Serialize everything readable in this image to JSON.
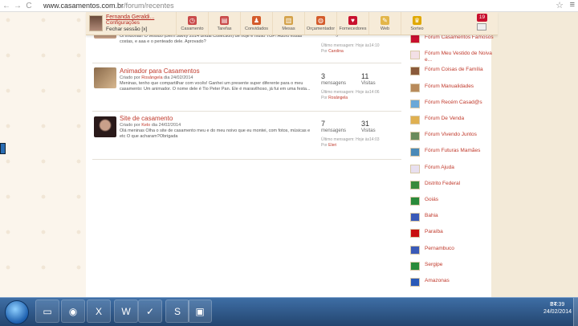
{
  "browser": {
    "url_host": "www.casamentos.com.br",
    "url_path": "/forum/recentes",
    "back": "←",
    "forward": "→",
    "reload": "C",
    "star": "☆",
    "menu": "≡"
  },
  "profile": {
    "name": "Fernanda Geraldi...",
    "settings": "Configurações",
    "logout": "Fechar sessão [x]"
  },
  "nav": [
    {
      "label": "Casamento",
      "color": "#c94a4a",
      "glyph": "◷"
    },
    {
      "label": "Tarefas",
      "color": "#c94a4a",
      "glyph": "▤"
    },
    {
      "label": "Convidados",
      "color": "#d45b2b",
      "glyph": "♟"
    },
    {
      "label": "Mesas",
      "color": "#d4a24a",
      "glyph": "▥"
    },
    {
      "label": "Orçamentador",
      "color": "#d45b2b",
      "glyph": "◍"
    },
    {
      "label": "Fornecedores",
      "color": "#c8102e",
      "glyph": "♥"
    },
    {
      "label": "Web",
      "color": "#e3b64a",
      "glyph": "✎"
    },
    {
      "label": "Sorteo",
      "color": "#e0a800",
      "glyph": "♛"
    }
  ],
  "notifications": "19",
  "topics": [
    {
      "title": "",
      "meta_pre": "",
      "user": "",
      "date": "",
      "desc": "Oi lindonas! O vestido (Bern Savvy 2014 Bridal Collection) de hoje é muito TOP! Adoro essas costas, e aaa e o penteado dele. Aprovado?",
      "num": "",
      "num_label": "mensagens",
      "visits": "",
      "visits_label": "Visitas",
      "last": "Último mensagem: Hoje às14:10",
      "last_by_pre": "Por",
      "last_by": "Carolina"
    },
    {
      "title": "Animador para Casamentos",
      "meta_pre": "Criado por",
      "user": "Rosângela",
      "date": "dia 24/02/2014",
      "desc": "Meninas, tenho que compartilhar com vocês! Ganhei um presente super diferente para o meu casamento: Um animador. O nome dele é Tio Peter Pan. Ele é maravilhoso, já fui em uma festa...",
      "num": "3",
      "num_label": "mensagens",
      "visits": "11",
      "visits_label": "Visitas",
      "last": "Último mensagem: Hoje às14:06",
      "last_by_pre": "Por",
      "last_by": "Rosângela"
    },
    {
      "title": "Site de casamento",
      "meta_pre": "Criado por",
      "user": "Kelo",
      "date": "dia 24/02/2014",
      "desc": "Olá meninas Olha o site de casamento meu e do meu noivo que eu montei, com fotos, músicas e etc O que acharam?Obrigada",
      "num": "7",
      "num_label": "mensagens",
      "visits": "31",
      "visits_label": "Visitas",
      "last": "Último mensagem: Hoje às14:03",
      "last_by_pre": "Por",
      "last_by": "Eleri"
    }
  ],
  "sidebar": [
    {
      "label": "Fórum Casamentos Famosos",
      "color": "#c8102e"
    },
    {
      "label": "Fórum Meu Vestido de Noiva e...",
      "color": "#f3e0e6"
    },
    {
      "label": "Fórum Coisas de Família",
      "color": "#8a5a3a"
    },
    {
      "label": "Fórum Manualidades",
      "color": "#b88a5a"
    },
    {
      "label": "Fórum Recém Casad@s",
      "color": "#6aa8d8"
    },
    {
      "label": "Fórum De Venda",
      "color": "#e0b050"
    },
    {
      "label": "Fórum Vivendo Juntos",
      "color": "#6a8a5a"
    },
    {
      "label": "Fórum Futuras Mamães",
      "color": "#4a8ab8"
    },
    {
      "label": "Fórum Ajuda",
      "color": "#e8e0f0"
    },
    {
      "label": "Distrito Federal",
      "color": "#3a8a3a"
    },
    {
      "label": "Goiás",
      "color": "#2a8a3a"
    },
    {
      "label": "Bahia",
      "color": "#3a5ab8"
    },
    {
      "label": "Paraíba",
      "color": "#c81010"
    },
    {
      "label": "Pernambuco",
      "color": "#3a5ab8"
    },
    {
      "label": "Sergipe",
      "color": "#2a8a3a"
    },
    {
      "label": "Amazonas",
      "color": "#2a5ab8"
    }
  ],
  "taskbar": {
    "lang": "PT",
    "time": "14:39",
    "date": "24/02/2014",
    "apps": [
      {
        "icon": "▭"
      },
      {
        "icon": "◉"
      },
      {
        "icon": "X"
      },
      {
        "icon": "W"
      },
      {
        "icon": "✓"
      },
      {
        "icon": "S"
      },
      {
        "icon": "▣"
      }
    ]
  }
}
